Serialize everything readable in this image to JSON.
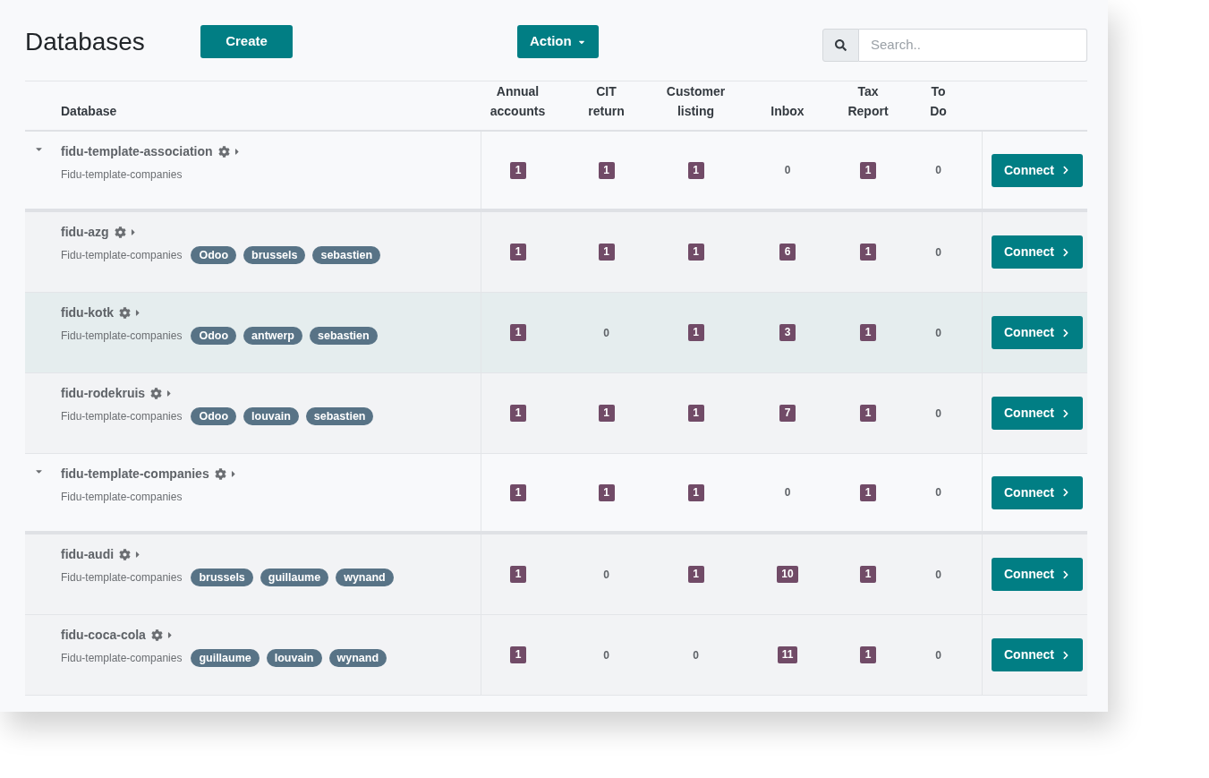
{
  "title": "Databases",
  "create_button": "Create",
  "action_button": "Action",
  "search": {
    "placeholder": "Search.."
  },
  "table": {
    "columns": [
      "Database",
      "Annual accounts",
      "CIT return",
      "Customer listing",
      "Inbox",
      "Tax Report",
      "To Do"
    ],
    "rows": [
      {
        "kind": "group",
        "expanded": true,
        "highlighted": false,
        "name": "fidu-template-association",
        "template": "Fidu-template-companies",
        "tags": [],
        "counts": [
          {
            "value": "1",
            "badge": true
          },
          {
            "value": "1",
            "badge": true
          },
          {
            "value": "1",
            "badge": true
          },
          {
            "value": "0",
            "badge": false
          },
          {
            "value": "1",
            "badge": true
          },
          {
            "value": "0",
            "badge": false
          }
        ],
        "button": "Connect"
      },
      {
        "kind": "child",
        "highlighted": false,
        "name": "fidu-azg",
        "template": "Fidu-template-companies",
        "tags": [
          "Odoo",
          "brussels",
          "sebastien"
        ],
        "counts": [
          {
            "value": "1",
            "badge": true
          },
          {
            "value": "1",
            "badge": true
          },
          {
            "value": "1",
            "badge": true
          },
          {
            "value": "6",
            "badge": true
          },
          {
            "value": "1",
            "badge": true
          },
          {
            "value": "0",
            "badge": false
          }
        ],
        "button": "Connect"
      },
      {
        "kind": "child",
        "highlighted": true,
        "name": "fidu-kotk",
        "template": "Fidu-template-companies",
        "tags": [
          "Odoo",
          "antwerp",
          "sebastien"
        ],
        "counts": [
          {
            "value": "1",
            "badge": true
          },
          {
            "value": "0",
            "badge": false
          },
          {
            "value": "1",
            "badge": true
          },
          {
            "value": "3",
            "badge": true
          },
          {
            "value": "1",
            "badge": true
          },
          {
            "value": "0",
            "badge": false
          }
        ],
        "button": "Connect"
      },
      {
        "kind": "child",
        "highlighted": false,
        "name": "fidu-rodekruis",
        "template": "Fidu-template-companies",
        "tags": [
          "Odoo",
          "louvain",
          "sebastien"
        ],
        "counts": [
          {
            "value": "1",
            "badge": true
          },
          {
            "value": "1",
            "badge": true
          },
          {
            "value": "1",
            "badge": true
          },
          {
            "value": "7",
            "badge": true
          },
          {
            "value": "1",
            "badge": true
          },
          {
            "value": "0",
            "badge": false
          }
        ],
        "button": "Connect"
      },
      {
        "kind": "group",
        "expanded": true,
        "highlighted": false,
        "name": "fidu-template-companies",
        "template": "Fidu-template-companies",
        "tags": [],
        "counts": [
          {
            "value": "1",
            "badge": true
          },
          {
            "value": "1",
            "badge": true
          },
          {
            "value": "1",
            "badge": true
          },
          {
            "value": "0",
            "badge": false
          },
          {
            "value": "1",
            "badge": true
          },
          {
            "value": "0",
            "badge": false
          }
        ],
        "button": "Connect"
      },
      {
        "kind": "child",
        "highlighted": false,
        "name": "fidu-audi",
        "template": "Fidu-template-companies",
        "tags": [
          "brussels",
          "guillaume",
          "wynand"
        ],
        "counts": [
          {
            "value": "1",
            "badge": true
          },
          {
            "value": "0",
            "badge": false
          },
          {
            "value": "1",
            "badge": true
          },
          {
            "value": "10",
            "badge": true
          },
          {
            "value": "1",
            "badge": true
          },
          {
            "value": "0",
            "badge": false
          }
        ],
        "button": "Connect"
      },
      {
        "kind": "child",
        "highlighted": false,
        "name": "fidu-coca-cola",
        "template": "Fidu-template-companies",
        "tags": [
          "guillaume",
          "louvain",
          "wynand"
        ],
        "counts": [
          {
            "value": "1",
            "badge": true
          },
          {
            "value": "0",
            "badge": false
          },
          {
            "value": "0",
            "badge": false
          },
          {
            "value": "11",
            "badge": true
          },
          {
            "value": "1",
            "badge": true
          },
          {
            "value": "0",
            "badge": false
          }
        ],
        "button": "Connect"
      }
    ]
  }
}
